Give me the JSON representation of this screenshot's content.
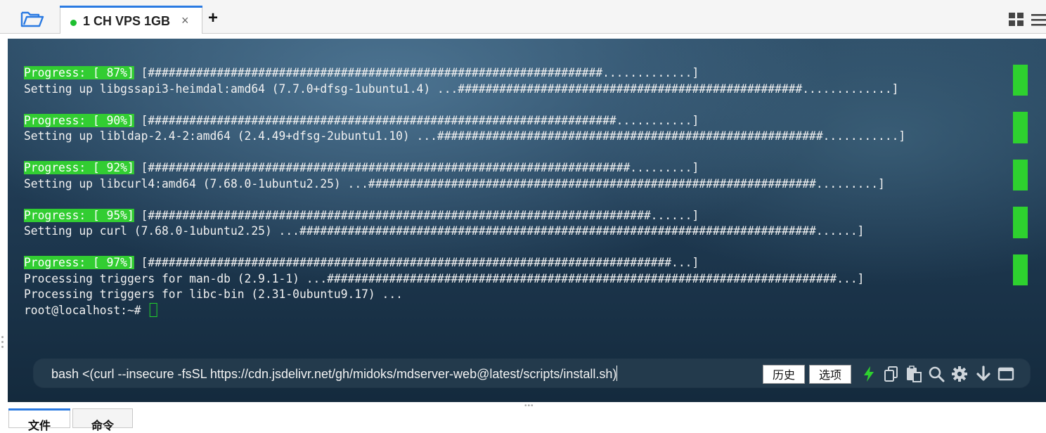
{
  "window": {
    "tab_title": "1 CH VPS 1GB",
    "tab_close": "×",
    "add_tab": "+"
  },
  "terminal": {
    "lines": [
      {
        "progress": "Progress: [ 87%]",
        "text": " [##################################################################.............]"
      },
      {
        "text": "Setting up libgssapi3-heimdal:amd64 (7.7.0+dfsg-1ubuntu1.4) ...##################################################.............]"
      },
      {
        "blank": true
      },
      {
        "progress": "Progress: [ 90%]",
        "text": " [####################################################################...........]"
      },
      {
        "text": "Setting up libldap-2.4-2:amd64 (2.4.49+dfsg-2ubuntu1.10) ...########################################################...........]"
      },
      {
        "blank": true
      },
      {
        "progress": "Progress: [ 92%]",
        "text": " [######################################################################.........]"
      },
      {
        "text": "Setting up libcurl4:amd64 (7.68.0-1ubuntu2.25) ...#################################################################.........]"
      },
      {
        "blank": true
      },
      {
        "progress": "Progress: [ 95%]",
        "text": " [#########################################################################......]"
      },
      {
        "text": "Setting up curl (7.68.0-1ubuntu2.25) ...###########################################################################......]"
      },
      {
        "blank": true
      },
      {
        "progress": "Progress: [ 97%]",
        "text": " [############################################################################...]"
      },
      {
        "text": "Processing triggers for man-db (2.9.1-1) ...##########################################################################...]"
      },
      {
        "text": "Processing triggers for libc-bin (2.31-0ubuntu9.17) ..."
      }
    ],
    "prompt": "root@localhost:~# "
  },
  "command_bar": {
    "input_value": "bash <(curl --insecure -fsSL https://cdn.jsdelivr.net/gh/midoks/mdserver-web@latest/scripts/install.sh)",
    "history_button": "历史",
    "options_button": "选项"
  },
  "bottom_tabs": {
    "files": "文件",
    "commands": "命令"
  },
  "colors": {
    "accent_blue": "#2a7ae2",
    "progress_green": "#32cd32",
    "status_dot": "#1dbf2f",
    "terminal_bg": "#1f3a52"
  },
  "icons": [
    "folder-icon",
    "grid-view-icon",
    "hamburger-menu-icon",
    "lightning-icon",
    "copy-icon",
    "paste-icon",
    "search-icon",
    "gear-icon",
    "download-arrow-icon",
    "window-icon"
  ]
}
